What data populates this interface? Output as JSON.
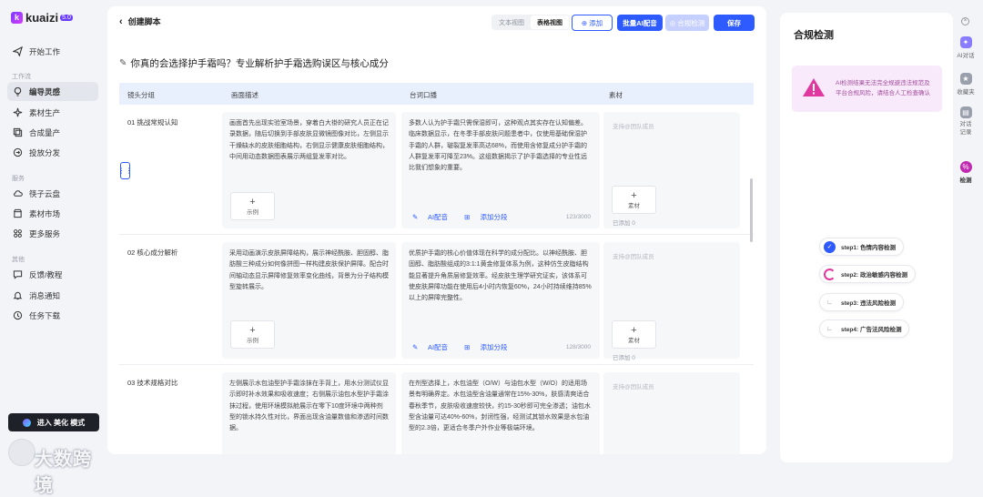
{
  "brand": {
    "name": "kuaizi",
    "version": "5.0"
  },
  "sidebar": {
    "top_items": [
      {
        "label": "开始工作",
        "icon": "paper-plane-icon"
      }
    ],
    "group1": "工作流",
    "items1": [
      {
        "label": "编导灵感",
        "icon": "bulb-icon",
        "active": true
      },
      {
        "label": "素材生产",
        "icon": "sparkle-icon"
      },
      {
        "label": "合成量产",
        "icon": "layers-icon"
      },
      {
        "label": "投放分发",
        "icon": "send-icon"
      }
    ],
    "group2": "服务",
    "items2": [
      {
        "label": "筷子云盘",
        "icon": "cloud-icon"
      },
      {
        "label": "素材市场",
        "icon": "market-icon"
      },
      {
        "label": "更多服务",
        "icon": "grid-icon"
      }
    ],
    "group3": "其他",
    "items3": [
      {
        "label": "反馈/教程",
        "icon": "chat-icon"
      },
      {
        "label": "消息通知",
        "icon": "bell-icon"
      },
      {
        "label": "任务下载",
        "icon": "download-icon"
      }
    ],
    "enter_button": "进入 美化 模式",
    "watermark": "大数跨境"
  },
  "toolbar": {
    "back_label": "创建脚本",
    "view_text": "文本视图",
    "view_table": "表格视图",
    "add": "添加",
    "ai_voice": "批量AI配音",
    "compliance": "合规检测",
    "save": "保存"
  },
  "doc": {
    "title": "你真的会选择护手霜吗？专业解析护手霜选购误区与核心成分"
  },
  "table": {
    "headers": [
      "镜头分组",
      "画面描述",
      "台词口播",
      "素材"
    ],
    "rows": [
      {
        "group": "01 挑战常规认知",
        "scene": "画面首先出现实验室场景，穿着白大褂的研究人员正在记录数据，随后切换到手部皮肤显微镜图像对比，左侧显示干燥缺水的皮肤细胞结构，右侧显示健康皮肤细胞结构，中间用动态数据图表展示两组复发率对比。",
        "script": "多数人认为护手霜只需保湿即可，这种观点其实存在认知偏差。临床数据显示，在冬季手部皮肤问题患者中，仅使用基础保湿护手霜的人群，皲裂复发率高达68%，而使用含修复成分护手霜的人群复发率可降至23%。这组数据揭示了护手霜选择的专业性远比我们想象的重要。",
        "count": "123/3000",
        "added": "已添加 0"
      },
      {
        "group": "02 核心成分解析",
        "scene": "采用动画演示皮肤屏障结构，展示神经酰胺、胆固醇、脂肪酸三种成分如何像拼图一样构建皮肤保护屏障。配合时间轴动态显示屏障修复效率变化曲线，背景为分子结构模型旋转展示。",
        "script": "优质护手霜的核心价值体现在科学的成分配比。以神经酰胺、胆固醇、脂肪酸组成的3:1:1黄金修复体系为例，这种仿生皮脂结构能显著提升角质层修复效率。经皮肤生理学研究证实，该体系可使皮肤屏障功能在使用后4小时内恢复60%，24小时持续维持85%以上的屏障完整性。",
        "count": "128/3000",
        "added": "已添加 0"
      },
      {
        "group": "03 技术规格对比",
        "scene": "左侧展示水包油型护手霜涂抹在手背上，用水分测试仪显示即时补水效果和吸收速度；右侧展示油包水型护手霜涂抹过程，使用环境模拟舱展示在零下10度环境中两种剂型的锁水持久性对比，界面出现含油量数值和渗透时间数据。",
        "script": "在剂型选择上，水包油型（O/W）与油包水型（W/O）的适用场景有明确界定。水包油型含油量通常在15%-30%，肤感清爽适合春秋季节，皮肤吸收速度较快，约15-30秒即可完全渗透；油包水型含油量可达40%-60%，封闭性强，经测试其锁水效果是水包油型的2.3倍，更适合冬季户外作业等极端环境。",
        "count": "",
        "added": ""
      }
    ],
    "example_label": "示例",
    "material_label": "素材",
    "material_placeholder": "支持@团队成员",
    "ai_voice_link": "AI配音",
    "add_segment_link": "添加分段"
  },
  "panel": {
    "title": "合规检测",
    "alert": "AI检测结果无法完全规避违法规范及平台合规风险，请结合人工检查确认",
    "steps": [
      {
        "label": "step1: 色情内容检测",
        "state": "done"
      },
      {
        "label": "step2: 政治敏感内容检测",
        "state": "running"
      },
      {
        "label": "step3: 违法风险检测",
        "state": "pending"
      },
      {
        "label": "step4: 广告法风险检测",
        "state": "pending"
      }
    ]
  },
  "rail": {
    "items": [
      {
        "label": "AI对话",
        "icon": "ai-chat-icon"
      },
      {
        "label": "收藏夹",
        "icon": "star-icon"
      },
      {
        "label": "对话记录",
        "icon": "history-icon"
      },
      {
        "label": "检测",
        "icon": "compliance-icon",
        "active": true
      }
    ]
  },
  "colors": {
    "accent": "#2d5bff",
    "header_bg": "#e9f0fd",
    "alert_bg": "#f8e9fb",
    "brand": "#7a3cff"
  }
}
